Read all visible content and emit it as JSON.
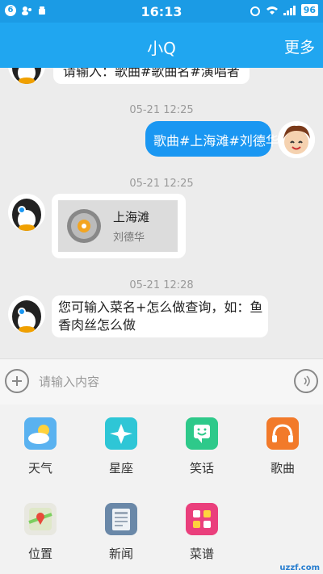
{
  "status_bar": {
    "notification_count": "6",
    "time": "16:13",
    "battery": "96"
  },
  "header": {
    "title": "小Q",
    "more": "更多"
  },
  "messages": {
    "top_partial": "请输入：歌曲#歌曲名#演唱者",
    "ts1": "05-21 12:25",
    "user_msg": "歌曲#上海滩#刘德华",
    "ts2": "05-21 12:25",
    "song_title": "上海滩",
    "song_artist": "刘德华",
    "ts3": "05-21 12:28",
    "bot_msg_line1": "您可输入菜名+怎么做查询，如：鱼",
    "bot_msg_line2": "香肉丝怎么做"
  },
  "input": {
    "placeholder": "请输入内容"
  },
  "tools": [
    {
      "label": "天气",
      "icon": "weather-icon",
      "color": "#5ab2f0"
    },
    {
      "label": "星座",
      "icon": "constellation-icon",
      "color": "#2ec6d6"
    },
    {
      "label": "笑话",
      "icon": "joke-icon",
      "color": "#2ec98a"
    },
    {
      "label": "歌曲",
      "icon": "music-icon",
      "color": "#f27a2a"
    },
    {
      "label": "位置",
      "icon": "location-icon",
      "color": "#e8e8e0"
    },
    {
      "label": "新闻",
      "icon": "news-icon",
      "color": "#6a88a8"
    },
    {
      "label": "菜谱",
      "icon": "recipe-icon",
      "color": "#ea3f7c"
    }
  ],
  "watermark": "uzzf.com"
}
